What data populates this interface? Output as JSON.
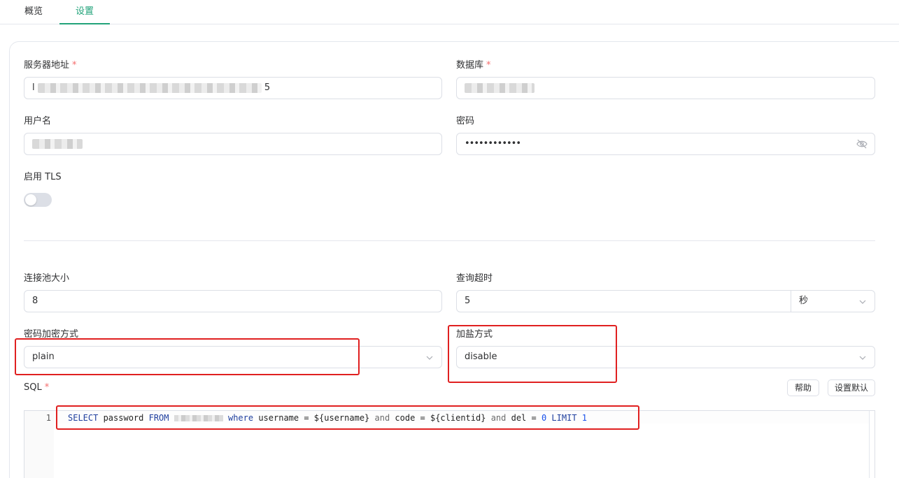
{
  "tabs": [
    {
      "label": "概览",
      "active": false
    },
    {
      "label": "设置",
      "active": true
    }
  ],
  "form": {
    "server": {
      "label": "服务器地址",
      "required": "*",
      "value_visible": "l",
      "value_tail": "5"
    },
    "database": {
      "label": "数据库",
      "required": "*"
    },
    "username": {
      "label": "用户名"
    },
    "password": {
      "label": "密码",
      "value": "••••••••••••"
    },
    "tls": {
      "label": "启用 TLS",
      "enabled": false
    },
    "pool_size": {
      "label": "连接池大小",
      "value": "8"
    },
    "query_timeout": {
      "label": "查询超时",
      "value": "5",
      "unit": "秒"
    },
    "password_hash": {
      "label": "密码加密方式",
      "value": "plain"
    },
    "salt": {
      "label": "加盐方式",
      "value": "disable"
    },
    "sql": {
      "label": "SQL",
      "required": "*"
    }
  },
  "buttons": {
    "help": "帮助",
    "reset_default": "设置默认"
  },
  "editor": {
    "line_number": "1",
    "tokens": {
      "select": "SELECT",
      "password": " password ",
      "from": "FROM",
      "where": "where",
      "t1": " username = ${username} ",
      "and1": "and",
      "t2": " code = ${clientid} ",
      "and2": "and",
      "t3": " del = ",
      "zero": "0",
      "limit": "LIMIT",
      "one": "1"
    }
  },
  "colors": {
    "accent": "#22a37a",
    "required": "#f56c6c",
    "annotation": "#e02020",
    "keyword": "#1f3f9e"
  }
}
